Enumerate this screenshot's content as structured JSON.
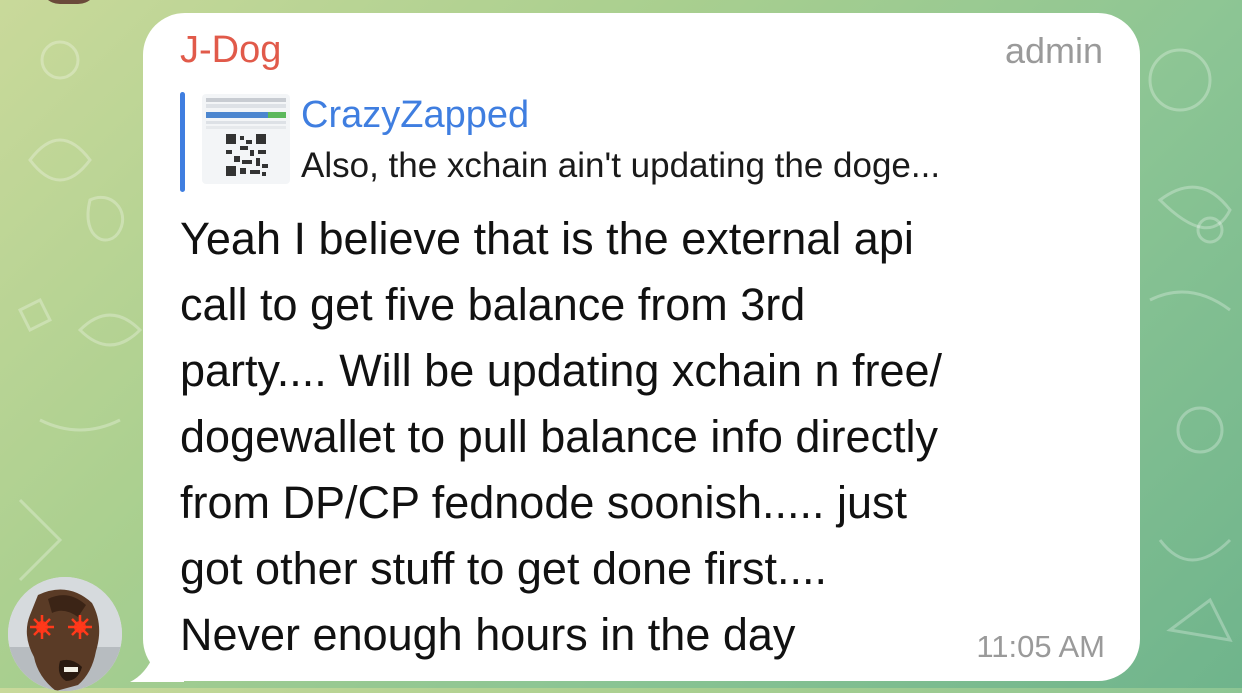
{
  "chat": {
    "message": {
      "sender": "J-Dog",
      "role": "admin",
      "time": "11:05 AM",
      "reply": {
        "author": "CrazyZapped",
        "preview": "Also, the xchain ain't updating the doge..."
      },
      "lines": [
        "Yeah I believe that is the external api",
        "call to get five balance from 3rd",
        "party.... Will be updating xchain n free/",
        "dogewallet to pull balance info directly",
        "from DP/CP fednode soonish..... just",
        "got other stuff to get done first....",
        "Never enough hours in the day"
      ]
    }
  },
  "colors": {
    "sender": "#e15a4a",
    "reply_accent": "#3f7ee0",
    "muted": "#9a9a9a",
    "bubble": "#ffffff"
  }
}
